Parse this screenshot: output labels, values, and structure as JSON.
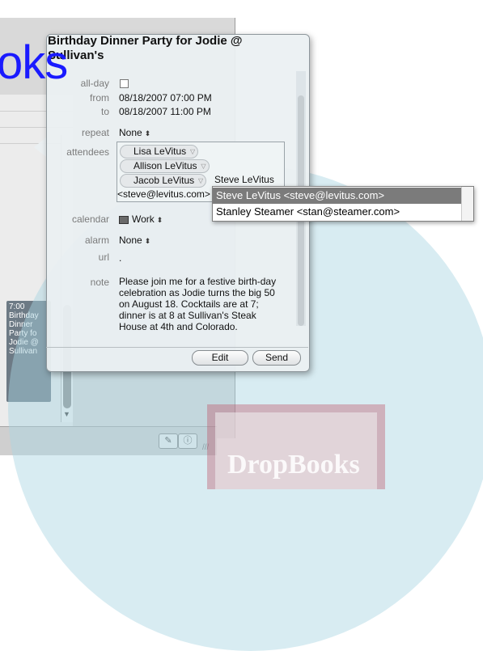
{
  "watermark": {
    "text": "DropBooks",
    "overlay_text": "oks"
  },
  "calendar_view": {
    "event": {
      "time": "7:00",
      "text": "Birthday Dinner Party fo Jodie @ Sullivan"
    }
  },
  "popover": {
    "title": "Birthday Dinner Party for Jodie @ Sullivan's",
    "all_day_label": "all-day",
    "from_label": "from",
    "from_value": "08/18/2007 07:00 PM",
    "to_label": "to",
    "to_value": "08/18/2007 11:00 PM",
    "repeat_label": "repeat",
    "repeat_value": "None",
    "attendees_label": "attendees",
    "attendees": [
      "Lisa LeVitus",
      "Allison LeVitus",
      "Jacob LeVitus"
    ],
    "typed_attendee": "Steve LeVitus",
    "typed_email": "<steve@levitus.com>",
    "calendar_label": "calendar",
    "calendar_value": "Work",
    "alarm_label": "alarm",
    "alarm_value": "None",
    "url_label": "url",
    "url_value": ".",
    "note_label": "note",
    "note_value": "Please join me for a festive birth-day celebration as Jodie turns the big 50 on August 18. Cocktails are at 7; dinner is at 8 at Sullivan's Steak House at 4th and  Colorado.",
    "edit_label": "Edit",
    "send_label": "Send"
  },
  "autocomplete": {
    "items": [
      "Steve LeVitus <steve@levitus.com>",
      "Stanley Steamer <stan@steamer.com>"
    ],
    "selected_index": 0
  },
  "colors": {
    "watermark_disc": "#a8d4e2",
    "overlay_text": "#1a1aff",
    "selection": "#7b7b7b"
  }
}
